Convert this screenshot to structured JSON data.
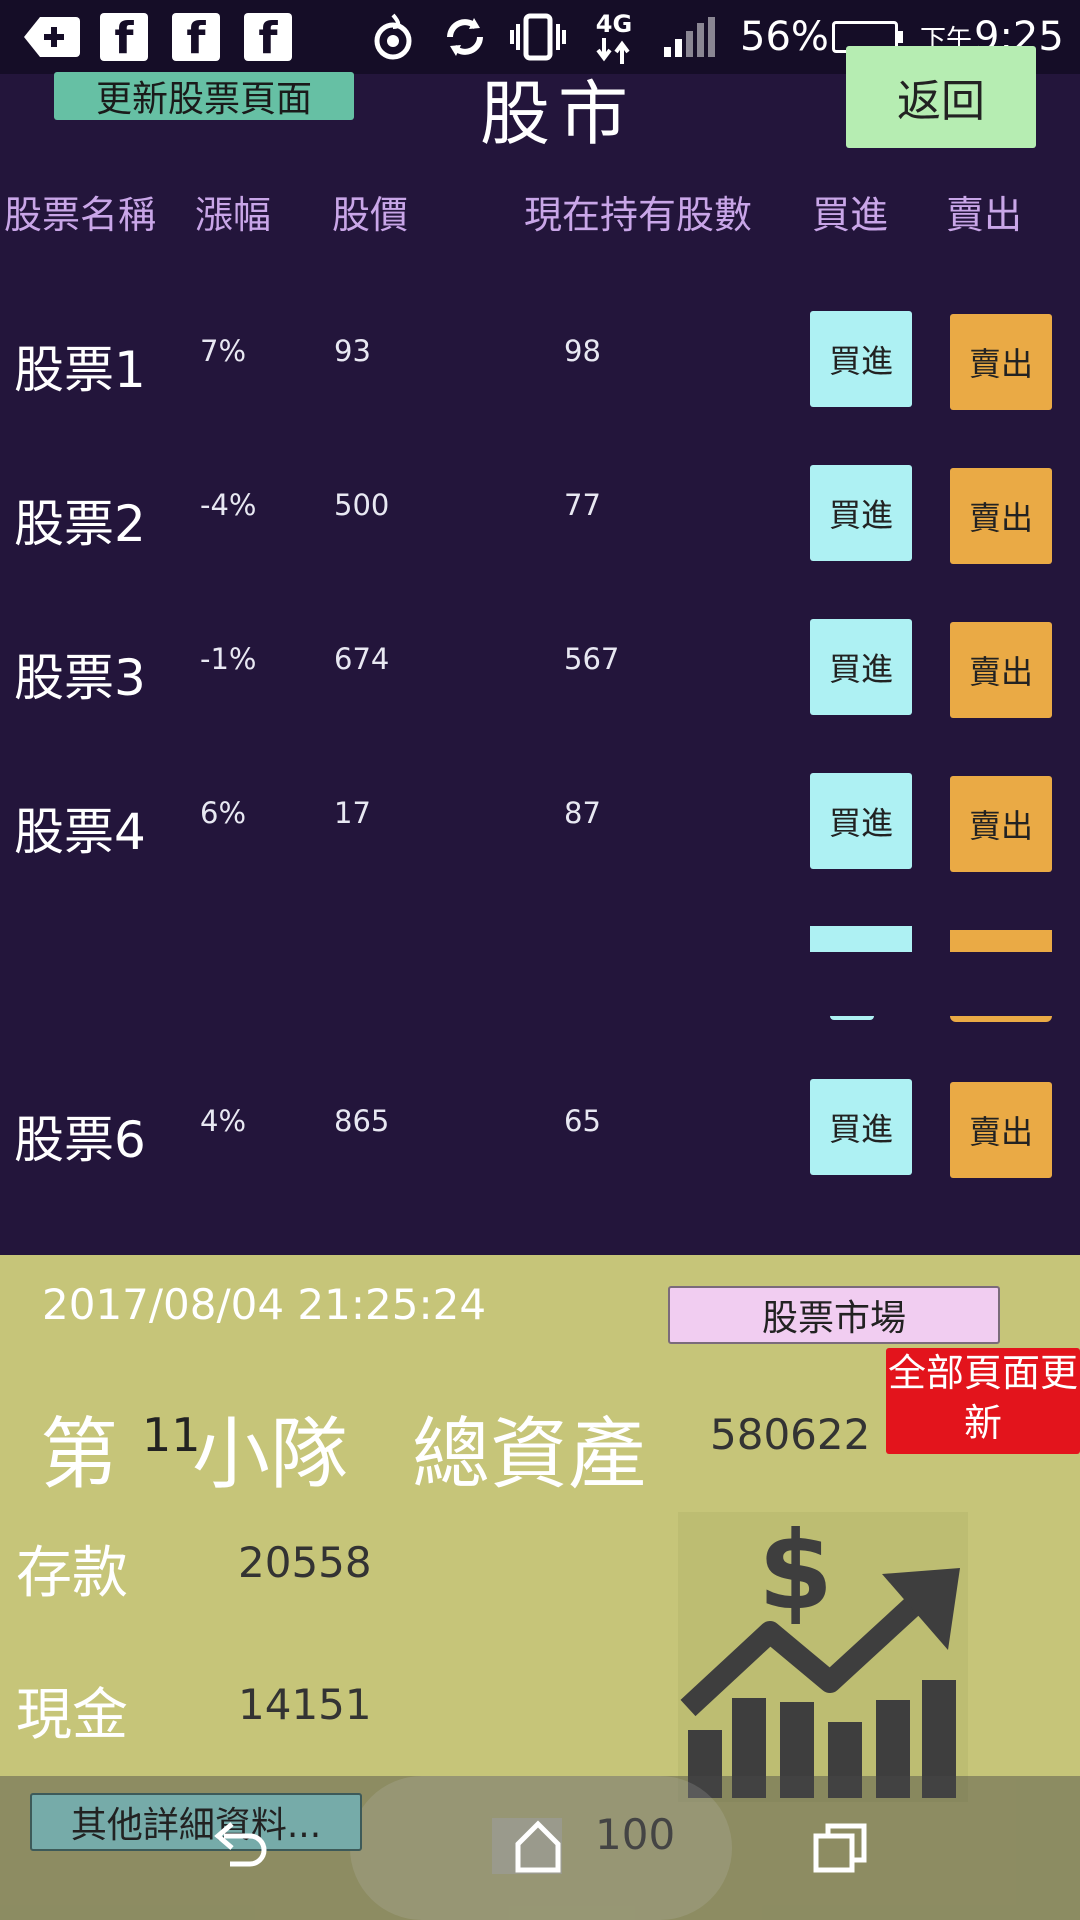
{
  "status_bar": {
    "battery": "56%",
    "time_prefix": "下午",
    "time": "9:25",
    "network": "4G"
  },
  "header": {
    "update_button": "更新股票頁面",
    "title": "股市",
    "back_button": "返回"
  },
  "columns": [
    "股票名稱",
    "漲幅",
    "股價",
    "現在持有股數",
    "買進",
    "賣出"
  ],
  "stocks": [
    {
      "name": "股票1",
      "change": "7%",
      "price": "93",
      "held": "98"
    },
    {
      "name": "股票2",
      "change": "-4%",
      "price": "500",
      "held": "77"
    },
    {
      "name": "股票3",
      "change": "-1%",
      "price": "674",
      "held": "567"
    },
    {
      "name": "股票4",
      "change": "6%",
      "price": "17",
      "held": "87"
    },
    {
      "name": "股票6",
      "change": "4%",
      "price": "865",
      "held": "65"
    }
  ],
  "buy_label": "買進",
  "sell_label": "賣出",
  "summary": {
    "datetime": "2017/08/04 21:25:24",
    "market_button": "股票市場",
    "refresh_button_line1": "全部頁面更",
    "refresh_button_line2": "新",
    "team_prefix": "第",
    "team_number": "11",
    "team_suffix": "小隊",
    "total_assets_label": "總資產",
    "total_assets": "580622",
    "deposit_label": "存款",
    "deposit": "20558",
    "cash_label": "現金",
    "cash": "14151",
    "details_button": "其他詳細資料..."
  },
  "navbar": {
    "count": "100"
  }
}
